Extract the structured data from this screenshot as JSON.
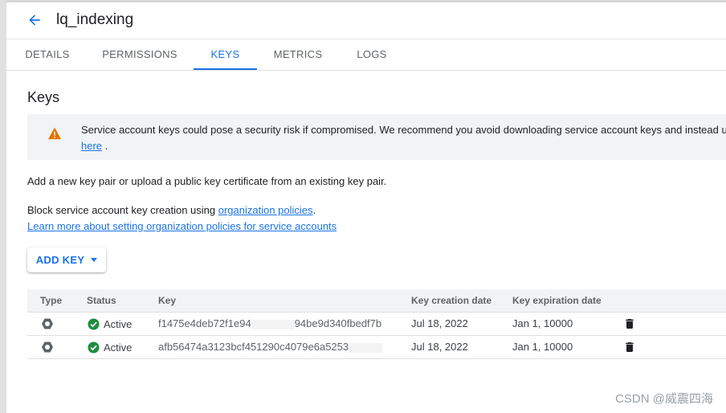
{
  "header": {
    "title": "lq_indexing"
  },
  "tabs": [
    {
      "label": "DETAILS",
      "active": false
    },
    {
      "label": "PERMISSIONS",
      "active": false
    },
    {
      "label": "KEYS",
      "active": true
    },
    {
      "label": "METRICS",
      "active": false
    },
    {
      "label": "LOGS",
      "active": false
    }
  ],
  "section": {
    "title": "Keys"
  },
  "banner": {
    "text": "Service account keys could pose a security risk if compromised. We recommend you avoid downloading service account keys and instead u",
    "link": "here",
    "after_link": " ."
  },
  "intro": "Add a new key pair or upload a public key certificate from an existing key pair.",
  "policy": {
    "prefix": "Block service account key creation using ",
    "link": "organization policies",
    "suffix": ".",
    "learn_more": "Learn more about setting organization policies for service accounts"
  },
  "add_key_label": "ADD KEY",
  "table": {
    "headers": {
      "type": "Type",
      "status": "Status",
      "key": "Key",
      "created": "Key creation date",
      "expires": "Key expiration date"
    },
    "rows": [
      {
        "status": "Active",
        "key_start": "f1475e4deb72f1e94",
        "key_end": "94be9d340fbedf7b",
        "created": "Jul 18, 2022",
        "expires": "Jan 1, 10000"
      },
      {
        "status": "Active",
        "key_start": "afb56474a3123bcf451290c4079e6a5253",
        "key_end": "",
        "created": "Jul 18, 2022",
        "expires": "Jan 1, 10000"
      }
    ]
  },
  "watermark": "CSDN @威震四海",
  "colors": {
    "accent": "#1a73e8",
    "warning": "#e37400",
    "success": "#1e8e3e"
  }
}
